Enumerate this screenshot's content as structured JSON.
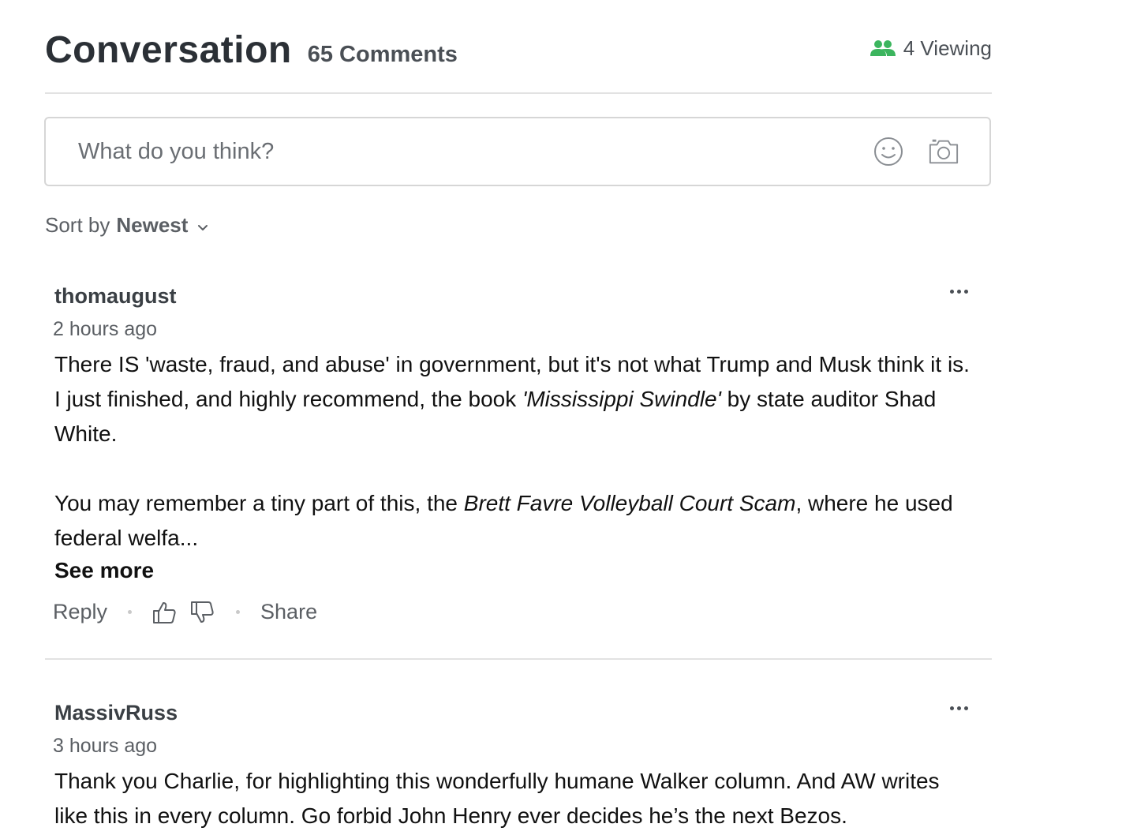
{
  "header": {
    "title": "Conversation",
    "comment_count": "65 Comments",
    "viewing": "4 Viewing",
    "viewing_icon": "users-icon"
  },
  "composer": {
    "placeholder": "What do you think?",
    "emoji_icon": "smiley-icon",
    "camera_icon": "camera-icon"
  },
  "sort": {
    "label": "Sort by",
    "value": "Newest"
  },
  "colors": {
    "accent_green": "#3cb55e",
    "text_dark": "#2b3036",
    "text_muted": "#5b5f64",
    "divider": "#e2e2e2"
  },
  "comments": [
    {
      "username": "thomaugust",
      "time": "2 hours ago",
      "p1_a": "There IS 'waste, fraud, and abuse' in government, but it's not what Trump and Musk think it is. I just finished, and highly recommend, the book ",
      "p1_em": "'Mississippi Swindle'",
      "p1_b": " by state auditor Shad White.",
      "p2_a": "You may remember a tiny part of this, the ",
      "p2_em": "Brett Favre Volleyball Court Scam",
      "p2_b": ", where he used federal welfa...",
      "see_more": "See more",
      "reply": "Reply",
      "share": "Share"
    },
    {
      "username": "MassivRuss",
      "time": "3 hours ago",
      "text": "Thank you Charlie, for highlighting this wonderfully humane Walker column. And AW writes like this in every column. Go forbid John Henry ever decides he’s the next Bezos."
    }
  ]
}
